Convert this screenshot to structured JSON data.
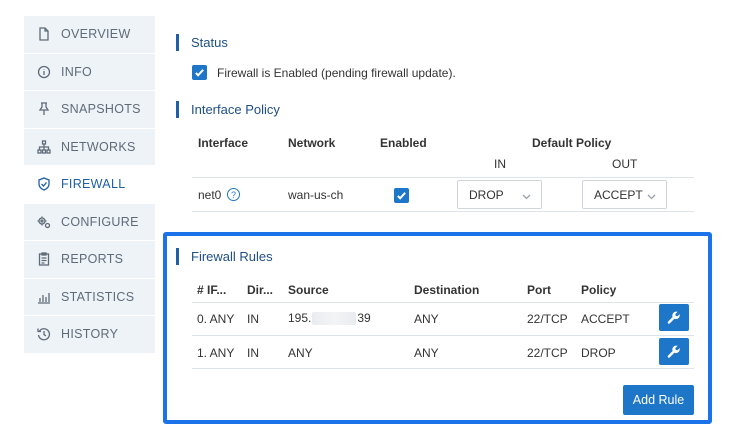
{
  "sidebar": {
    "items": [
      {
        "label": "OVERVIEW",
        "icon": "document-icon"
      },
      {
        "label": "INFO",
        "icon": "info-icon"
      },
      {
        "label": "SNAPSHOTS",
        "icon": "pin-icon"
      },
      {
        "label": "NETWORKS",
        "icon": "network-icon"
      },
      {
        "label": "FIREWALL",
        "icon": "shield-icon",
        "active": true
      },
      {
        "label": "CONFIGURE",
        "icon": "gears-icon"
      },
      {
        "label": "REPORTS",
        "icon": "clipboard-icon"
      },
      {
        "label": "STATISTICS",
        "icon": "bar-chart-icon"
      },
      {
        "label": "HISTORY",
        "icon": "history-icon"
      }
    ]
  },
  "status": {
    "title": "Status",
    "checkbox_label": "Firewall is Enabled (pending firewall update).",
    "checked": true
  },
  "interface_policy": {
    "title": "Interface Policy",
    "headers": {
      "interface": "Interface",
      "network": "Network",
      "enabled": "Enabled",
      "default_policy": "Default Policy",
      "in": "IN",
      "out": "OUT"
    },
    "rows": [
      {
        "interface": "net0",
        "help": "?",
        "network": "wan-us-ch",
        "enabled": true,
        "in": "DROP",
        "out": "ACCEPT"
      }
    ]
  },
  "firewall_rules": {
    "title": "Firewall Rules",
    "headers": {
      "if": "# IF...",
      "dir": "Dir...",
      "source": "Source",
      "destination": "Destination",
      "port": "Port",
      "policy": "Policy"
    },
    "rows": [
      {
        "if": "0. ANY",
        "dir": "IN",
        "source_prefix": "195.",
        "source_suffix": "39",
        "destination": "ANY",
        "port": "22/TCP",
        "policy": "ACCEPT"
      },
      {
        "if": "1. ANY",
        "dir": "IN",
        "source": "ANY",
        "destination": "ANY",
        "port": "22/TCP",
        "policy": "DROP"
      }
    ],
    "add_button": "Add Rule"
  },
  "colors": {
    "accent": "#1e76c9",
    "highlight_border": "#1a73e8",
    "sidebar_bg": "#eef3f8",
    "heading": "#1f4f86"
  }
}
